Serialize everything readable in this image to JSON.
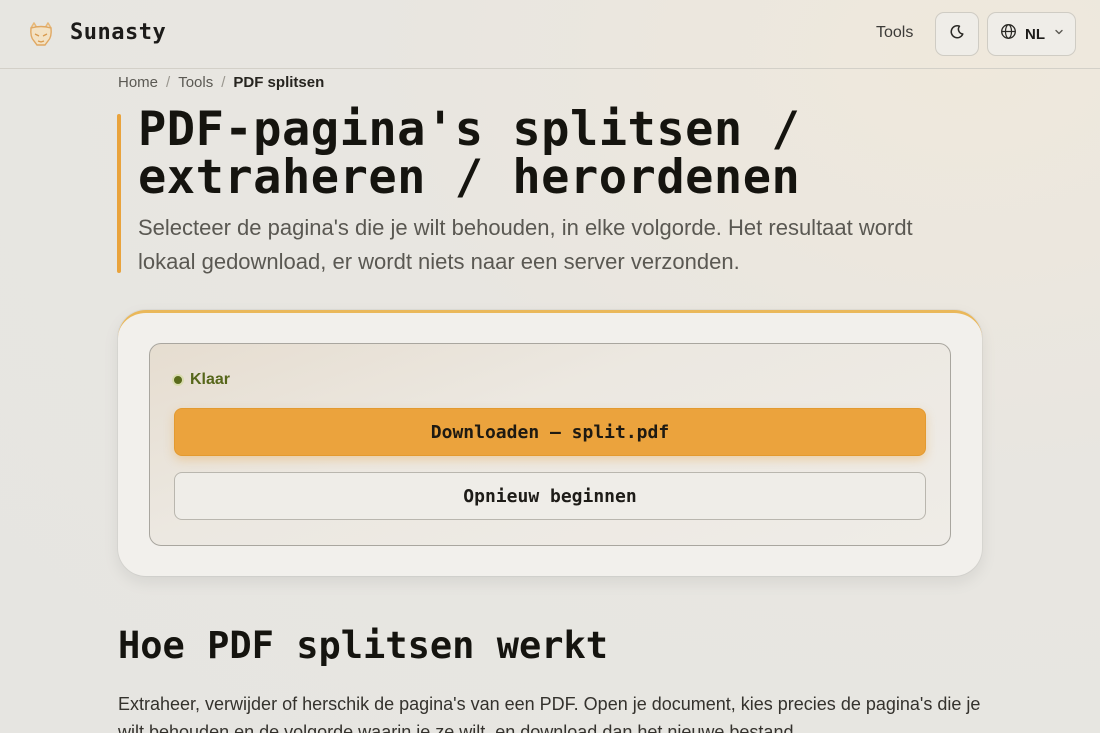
{
  "header": {
    "brand": "Sunasty",
    "nav_tools": "Tools",
    "language": "NL"
  },
  "breadcrumb": {
    "items": [
      "Home",
      "Tools",
      "PDF splitsen"
    ]
  },
  "hero": {
    "title_line1": "PDF-pagina's splitsen /",
    "title_line2": "extraheren / herordenen",
    "subtitle": "Selecteer de pagina's die je wilt behouden, in elke volgorde. Het resultaat wordt lokaal gedownload, er wordt niets naar een server verzonden."
  },
  "result": {
    "status": "Klaar",
    "download_label": "Downloaden — split.pdf",
    "restart_label": "Opnieuw beginnen"
  },
  "how": {
    "title": "Hoe PDF splitsen werkt",
    "body": "Extraheer, verwijder of herschik de pagina's van een PDF. Open je document, kies precies de pagina's die je wilt behouden en de volgorde waarin je ze wilt, en download dan het nieuwe bestand."
  },
  "colors": {
    "accent": "#eba33d",
    "status_green": "#56661a",
    "background": "#e8e6e1"
  },
  "icons": {
    "logo": "fox-logo-icon",
    "theme": "moon-icon",
    "language": "globe-icon",
    "dropdown": "chevron-down-icon"
  }
}
